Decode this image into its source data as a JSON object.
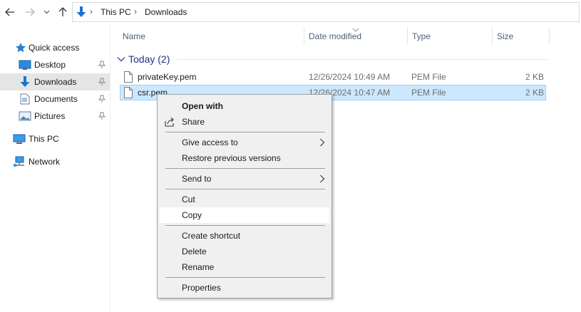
{
  "window": {
    "breadcrumbs": [
      "This PC",
      "Downloads"
    ]
  },
  "sidebar": {
    "items": [
      {
        "label": "Quick access",
        "icon": "star-icon",
        "pinned": false
      },
      {
        "label": "Desktop",
        "icon": "desktop-icon",
        "pinned": true
      },
      {
        "label": "Downloads",
        "icon": "download-arrow-icon",
        "pinned": true,
        "selected": true
      },
      {
        "label": "Documents",
        "icon": "documents-icon",
        "pinned": true
      },
      {
        "label": "Pictures",
        "icon": "pictures-icon",
        "pinned": true
      },
      {
        "label": "This PC",
        "icon": "computer-icon",
        "pinned": false
      },
      {
        "label": "Network",
        "icon": "network-icon",
        "pinned": false
      }
    ]
  },
  "columns": {
    "name": "Name",
    "date": "Date modified",
    "type": "Type",
    "size": "Size"
  },
  "group": {
    "label": "Today (2)"
  },
  "files": [
    {
      "name": "privateKey.pem",
      "date": "12/26/2024 10:49 AM",
      "type": "PEM File",
      "size": "2 KB",
      "selected": false
    },
    {
      "name": "csr.pem",
      "date": "12/26/2024 10:47 AM",
      "type": "PEM File",
      "size": "2 KB",
      "selected": true
    }
  ],
  "context_menu": {
    "open_with": "Open with",
    "share": "Share",
    "give_access": "Give access to",
    "restore": "Restore previous versions",
    "send_to": "Send to",
    "cut": "Cut",
    "copy": "Copy",
    "create_shortcut": "Create shortcut",
    "delete": "Delete",
    "rename": "Rename",
    "properties": "Properties"
  },
  "colors": {
    "accent": "#0078d7",
    "selection": "#cce8ff",
    "group_header": "#1e3287",
    "menu_bg": "#f0f0f0"
  }
}
